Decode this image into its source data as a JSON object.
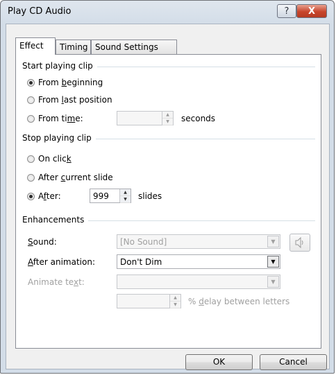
{
  "window": {
    "title": "Play CD Audio",
    "help_label": "?",
    "close_label": "X"
  },
  "tabs": [
    {
      "label": "Effect",
      "active": true
    },
    {
      "label": "Timing",
      "active": false
    },
    {
      "label": "Sound Settings",
      "active": false
    }
  ],
  "start": {
    "group_label": "Start playing clip",
    "opt_beginning": {
      "pre": "From ",
      "key": "b",
      "post": "eginning",
      "selected": true
    },
    "opt_last": {
      "pre": "From ",
      "key": "l",
      "post": "ast position",
      "selected": false
    },
    "opt_time": {
      "pre": "From ti",
      "key": "m",
      "post": "e:",
      "selected": false
    },
    "time_value": "",
    "seconds_label": "seconds"
  },
  "stop": {
    "group_label": "Stop playing clip",
    "opt_click": {
      "pre": "On clic",
      "key": "k",
      "post": "",
      "selected": false
    },
    "opt_slide": {
      "pre": "After ",
      "key": "c",
      "post": "urrent slide",
      "selected": false
    },
    "opt_after": {
      "pre": "A",
      "key": "f",
      "post": "ter:",
      "selected": true
    },
    "after_value": "999",
    "slides_label": "slides"
  },
  "enh": {
    "group_label": "Enhancements",
    "sound_label": {
      "pre": "",
      "key": "S",
      "post": "ound:"
    },
    "sound_value": "[No Sound]",
    "after_anim_label": {
      "pre": "",
      "key": "A",
      "post": "fter animation:"
    },
    "after_anim_value": "Don't Dim",
    "animate_text_label": {
      "pre": "Animate te",
      "key": "x",
      "post": "t:"
    },
    "animate_text_value": "",
    "delay_value": "",
    "delay_label": {
      "pre": "% ",
      "key": "d",
      "post": "elay between letters"
    }
  },
  "buttons": {
    "ok": "OK",
    "cancel": "Cancel"
  },
  "icons": {
    "speaker": "speaker-icon",
    "help": "question-mark-icon",
    "close": "close-icon"
  }
}
